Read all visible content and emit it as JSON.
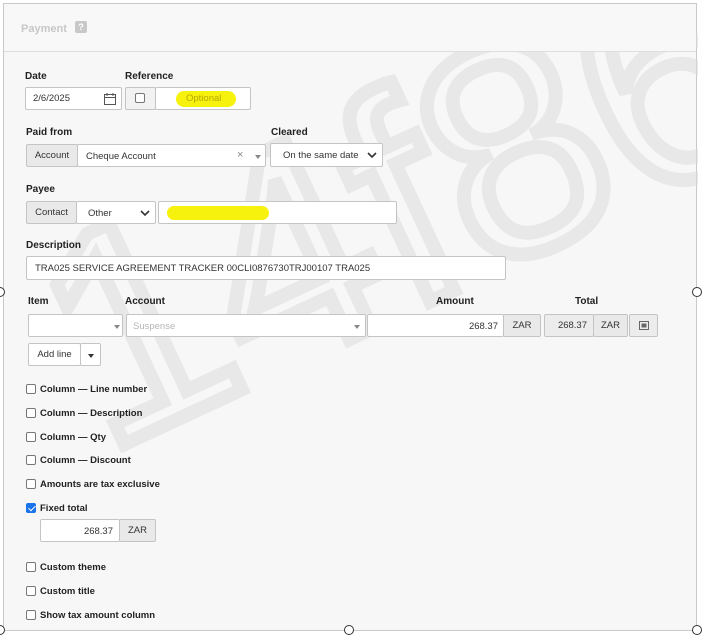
{
  "panel": {
    "title": "Payment",
    "help_glyph": "?"
  },
  "date": {
    "label": "Date",
    "value": "2/6/2025"
  },
  "reference": {
    "label": "Reference",
    "placeholder": "Optional"
  },
  "paid_from": {
    "label": "Paid from",
    "addon": "Account",
    "value": "Cheque Account"
  },
  "cleared": {
    "label": "Cleared",
    "value": "On the same date"
  },
  "payee": {
    "label": "Payee",
    "addon": "Contact",
    "type_value": "Other"
  },
  "description": {
    "label": "Description",
    "value": "TRA025 SERVICE AGREEMENT TRACKER   00CLI0876730TRJ00107 TRA025"
  },
  "lines": {
    "headers": {
      "item": "Item",
      "account": "Account",
      "amount": "Amount",
      "total": "Total"
    },
    "row": {
      "account_placeholder": "Suspense",
      "amount": "268.37",
      "amount_currency": "ZAR",
      "total": "268.37",
      "total_currency": "ZAR"
    },
    "add_line_label": "Add line"
  },
  "options": [
    {
      "label": "Column — Line number",
      "checked": false
    },
    {
      "label": "Column — Description",
      "checked": false
    },
    {
      "label": "Column — Qty",
      "checked": false
    },
    {
      "label": "Column — Discount",
      "checked": false
    },
    {
      "label": "Amounts are tax exclusive",
      "checked": false
    },
    {
      "label": "Fixed total",
      "checked": true
    }
  ],
  "fixed_total": {
    "value": "268.37",
    "currency": "ZAR"
  },
  "options2": [
    {
      "label": "Custom theme",
      "checked": false
    },
    {
      "label": "Custom title",
      "checked": false
    },
    {
      "label": "Show tax amount column",
      "checked": false
    }
  ],
  "colors": {
    "highlight": "#f5f000",
    "checkbox_checked": "#1a73e8"
  },
  "watermark": {
    "text": "14f8681"
  }
}
